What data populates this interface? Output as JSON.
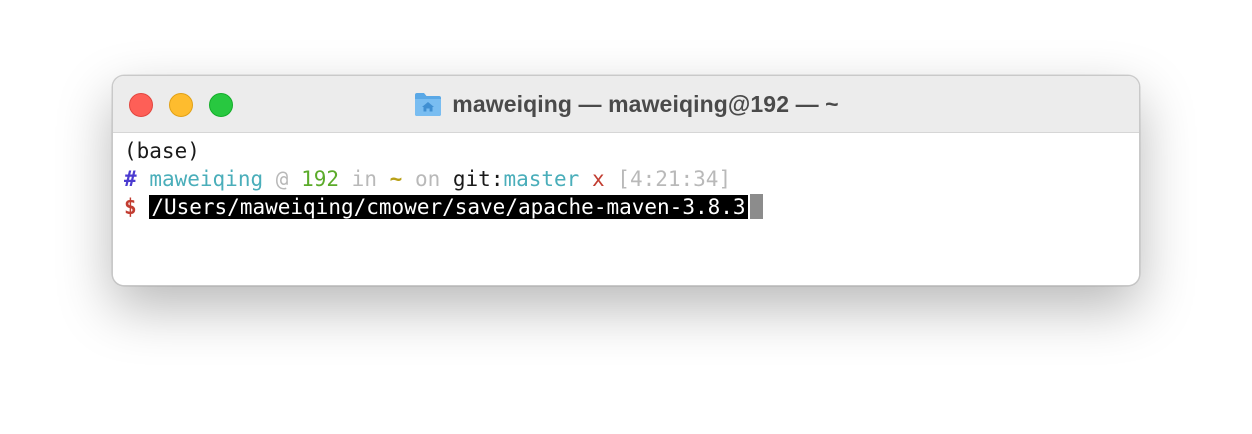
{
  "window": {
    "title": "maweiqing — maweiqing@192 — ~",
    "title_icon": "home-folder-icon",
    "controls": {
      "close": "close-button",
      "minimize": "minimize-button",
      "zoom": "zoom-button"
    }
  },
  "terminal": {
    "line1": {
      "text": "(base)"
    },
    "line2": {
      "hash": "#",
      "user": "maweiqing",
      "at": "@",
      "host": "192",
      "in": "in",
      "dir": "~",
      "on": "on",
      "git_label": "git:",
      "branch": "master",
      "dirty": "x",
      "time": "[4:21:34]"
    },
    "line3": {
      "prompt": "$",
      "command": "/Users/maweiqing/cmower/save/apache-maven-3.8.3"
    }
  },
  "colors": {
    "hash": "#4b3bd0",
    "user": "#4aaeba",
    "host": "#5bab2a",
    "tilde": "#b9a017",
    "dirty": "#c23d31",
    "prompt": "#c23d31",
    "dim": "#b9b9b9"
  }
}
